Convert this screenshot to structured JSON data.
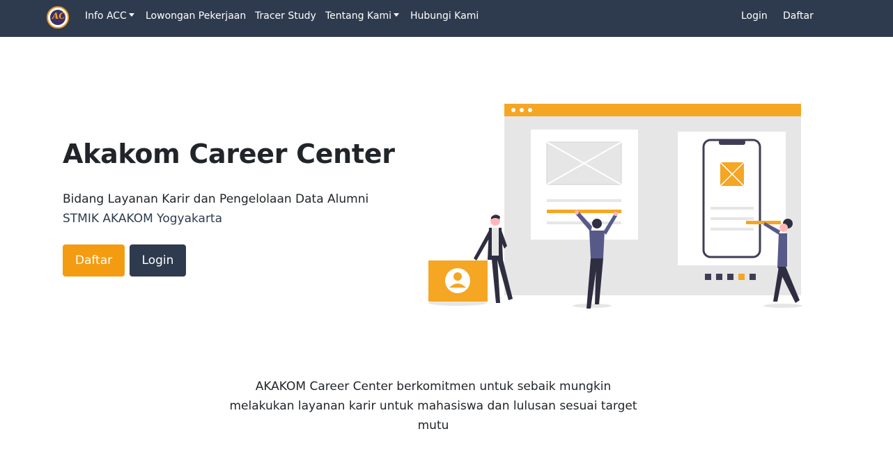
{
  "nav": {
    "logo_text": "AC",
    "items": [
      {
        "label": "Info ACC",
        "dropdown": true
      },
      {
        "label": "Lowongan Pekerjaan",
        "dropdown": false
      },
      {
        "label": "Tracer Study",
        "dropdown": false
      },
      {
        "label": "Tentang Kami",
        "dropdown": true
      },
      {
        "label": "Hubungi Kami",
        "dropdown": false
      }
    ],
    "login_label": "Login",
    "register_label": "Daftar"
  },
  "hero": {
    "title": "Akakom Career Center",
    "subtitle_line1": "Bidang Layanan Karir dan Pengelolaan Data Alumni",
    "subtitle_line2": "STMIK AKAKOM Yogyakarta",
    "register_button": "Daftar",
    "login_button": "Login"
  },
  "mission": {
    "text": "AKAKOM Career Center berkomitmen untuk sebaik mungkin melakukan layanan karir untuk mahasiswa dan lulusan sesuai target mutu"
  },
  "colors": {
    "navbar": "#2e3b4e",
    "accent": "#f39c12",
    "dark_button": "#2e3b4e"
  }
}
